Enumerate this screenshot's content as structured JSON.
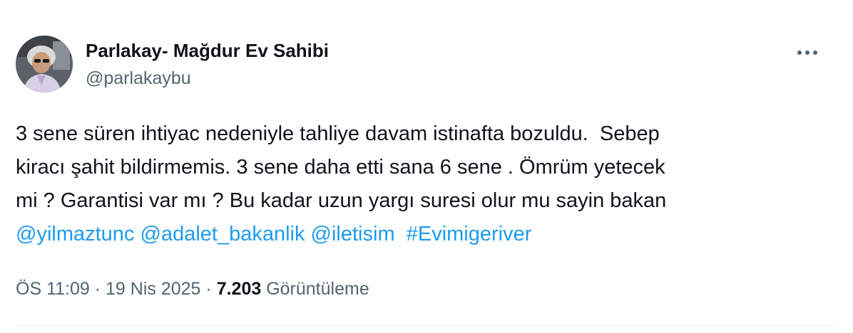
{
  "author": {
    "name": "Parlakay- Mağdur Ev Sahibi",
    "handle": "@parlakaybu",
    "avatar_icon": "profile-photo"
  },
  "more_icon": "more-horizontal-icon",
  "tweet": {
    "line1": "3 sene süren ihtiyac nedeniyle tahliye davam istinafta bozuldu.  Sebep",
    "line2": "kiracı şahit bildirmemis. 3 sene daha etti sana 6 sene . Ömrüm yetecek",
    "line3": "mi ? Garantisi var mı ? Bu kadar uzun yargı suresi olur mu sayin bakan",
    "mentions": [
      "@yilmaztunc",
      "@adalet_bakanlik",
      "@iletisim"
    ],
    "hashtag": "#Evimigeriver"
  },
  "meta": {
    "time": "ÖS 11:09",
    "separator": "·",
    "date": "19 Nis 2025",
    "views": "7.203",
    "views_label": "Görüntüleme"
  },
  "colors": {
    "link": "#1d9bf0",
    "secondary": "#536471",
    "text": "#0f1419"
  }
}
